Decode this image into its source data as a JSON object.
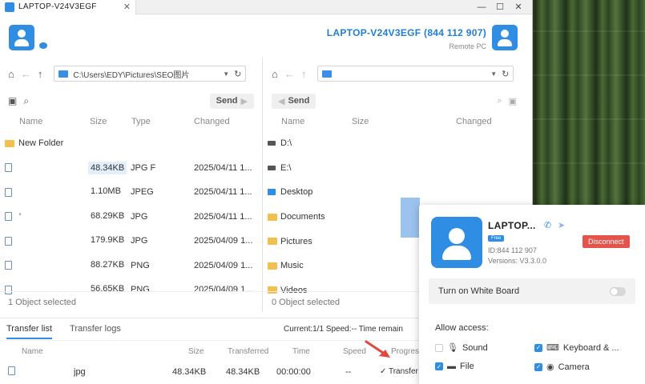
{
  "window": {
    "tab_title": "LAPTOP-V24V3EGF",
    "tab_close": "✕",
    "minimize": "—",
    "maximize": "☐",
    "close": "✕"
  },
  "header": {
    "remote_name": "LAPTOP-V24V3EGF (844 112 907)",
    "remote_label": "Remote PC"
  },
  "local_pane": {
    "path": "C:\\Users\\EDY\\Pictures\\SEO图片",
    "send_label": "Send",
    "columns": [
      "Name",
      "Size",
      "Type",
      "Changed"
    ],
    "rows": [
      {
        "icon": "folder",
        "name": "New Folder",
        "size": "",
        "type": "",
        "changed": ""
      },
      {
        "icon": "file",
        "name": "",
        "size": "48.34KB",
        "type": "JPG F",
        "changed": "2025/04/11 1...",
        "highlight": true
      },
      {
        "icon": "file",
        "name": "",
        "size": "1.10MB",
        "type": "JPEG",
        "changed": "2025/04/11 1..."
      },
      {
        "icon": "file",
        "name": "'",
        "size": "68.29KB",
        "type": "JPG",
        "changed": "2025/04/11 1..."
      },
      {
        "icon": "file",
        "name": "",
        "size": "179.9KB",
        "type": "JPG",
        "changed": "2025/04/09 1..."
      },
      {
        "icon": "file",
        "name": "",
        "size": "88.27KB",
        "type": "PNG",
        "changed": "2025/04/09 1..."
      },
      {
        "icon": "file",
        "name": "",
        "size": "56.65KB",
        "type": "PNG",
        "changed": "2025/04/09 1..."
      }
    ],
    "status": "1 Object selected"
  },
  "remote_pane": {
    "path": "",
    "send_label": "Send",
    "columns": [
      "Name",
      "Size",
      "Changed"
    ],
    "rows": [
      {
        "icon": "drive",
        "name": "D:\\"
      },
      {
        "icon": "drive",
        "name": "E:\\"
      },
      {
        "icon": "desktop",
        "name": "Desktop"
      },
      {
        "icon": "folder",
        "name": "Documents"
      },
      {
        "icon": "folder",
        "name": "Pictures"
      },
      {
        "icon": "folder",
        "name": "Music"
      },
      {
        "icon": "folder",
        "name": "Videos"
      }
    ],
    "status": "0 Object selected"
  },
  "transfer": {
    "tabs": [
      "Transfer list",
      "Transfer logs"
    ],
    "stats": "Current:1/1   Speed:--   Time remain",
    "columns": [
      "Name",
      "Size",
      "Transferred",
      "Time",
      "Speed",
      "Progres"
    ],
    "row": {
      "name": "jpg",
      "size": "48.34KB",
      "transferred": "48.34KB",
      "time": "00:00:00",
      "speed": "--",
      "progress": "✓ Transfer"
    }
  },
  "popup": {
    "name": "LAPTOP...",
    "badge": "Free",
    "id": "ID:844 112 907",
    "version": "Versions: V3.3.0.0",
    "disconnect": "Disconnect",
    "whiteboard_label": "Turn on White Board",
    "whiteboard_on": false,
    "allow_label": "Allow access:",
    "permissions": [
      {
        "label": "Sound",
        "checked": false,
        "icon": "microphone-icon"
      },
      {
        "label": "Keyboard & ...",
        "checked": true,
        "icon": "keyboard-icon"
      },
      {
        "label": "File",
        "checked": true,
        "icon": "folder-icon"
      },
      {
        "label": "Camera",
        "checked": true,
        "icon": "camera-icon"
      }
    ]
  },
  "colors": {
    "accent": "#2f8de4",
    "danger": "#e4544c",
    "row_highlight": "#e3eefb"
  }
}
